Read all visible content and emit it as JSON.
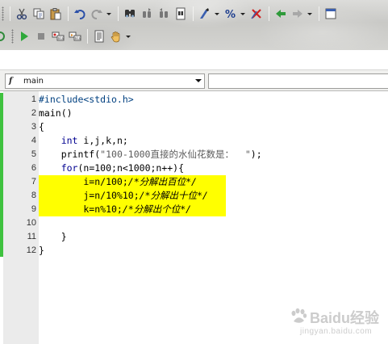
{
  "toolbar": {
    "row1": [
      "cut-icon",
      "copy-icon",
      "paste-icon",
      "undo-icon",
      "redo-icon",
      "find-icon",
      "find-next-icon",
      "find-prev-icon",
      "find-in-files-icon",
      "toggle-bookmark-icon",
      "percent-icon",
      "delete-bookmark-icon",
      "go-back-icon",
      "go-forward-icon",
      "window-icon"
    ],
    "row2": [
      "run-icon",
      "stop-icon",
      "breakpoint-icon",
      "step-icon",
      "document-icon",
      "hand-icon"
    ]
  },
  "navigation": {
    "symbol_icon": "f",
    "symbol_name": "main"
  },
  "editor": {
    "highlight_color": "#ffff00",
    "change_bar_color": "#3fc23f",
    "lines": [
      {
        "num": "1",
        "segments": [
          {
            "cls": "pp",
            "text": "#include<stdio.h>"
          }
        ]
      },
      {
        "num": "2",
        "segments": [
          {
            "cls": "",
            "text": "main()"
          }
        ]
      },
      {
        "num": "3",
        "segments": [
          {
            "cls": "",
            "text": "{"
          }
        ]
      },
      {
        "num": "4",
        "segments": [
          {
            "cls": "",
            "text": "    "
          },
          {
            "cls": "kw",
            "text": "int"
          },
          {
            "cls": "",
            "text": " i,j,k,n;"
          }
        ]
      },
      {
        "num": "5",
        "segments": [
          {
            "cls": "",
            "text": "    printf("
          },
          {
            "cls": "str",
            "text": "\"100-1000直接的水仙花数是：  \""
          },
          {
            "cls": "",
            "text": ");"
          }
        ]
      },
      {
        "num": "6",
        "segments": [
          {
            "cls": "",
            "text": "    "
          },
          {
            "cls": "kw",
            "text": "for"
          },
          {
            "cls": "",
            "text": "(n=100;n<1000;n++){"
          }
        ]
      },
      {
        "num": "7",
        "highlight": true,
        "segments": [
          {
            "cls": "",
            "text": "        i=n/100;"
          },
          {
            "cls": "cmt",
            "text": "/*分解出百位*/"
          }
        ]
      },
      {
        "num": "8",
        "highlight": true,
        "segments": [
          {
            "cls": "",
            "text": "        j=n/10%10;"
          },
          {
            "cls": "cmt",
            "text": "/*分解出十位*/"
          }
        ]
      },
      {
        "num": "9",
        "highlight": true,
        "segments": [
          {
            "cls": "",
            "text": "        k=n%10;"
          },
          {
            "cls": "cmt",
            "text": "/*分解出个位*/"
          }
        ]
      },
      {
        "num": "10",
        "segments": [
          {
            "cls": "",
            "text": ""
          }
        ]
      },
      {
        "num": "11",
        "segments": [
          {
            "cls": "",
            "text": "    }"
          }
        ]
      },
      {
        "num": "12",
        "segments": [
          {
            "cls": "",
            "text": "}"
          }
        ]
      }
    ]
  },
  "watermark": {
    "brand": "Baidu经验",
    "url": "jingyan.baidu.com"
  }
}
